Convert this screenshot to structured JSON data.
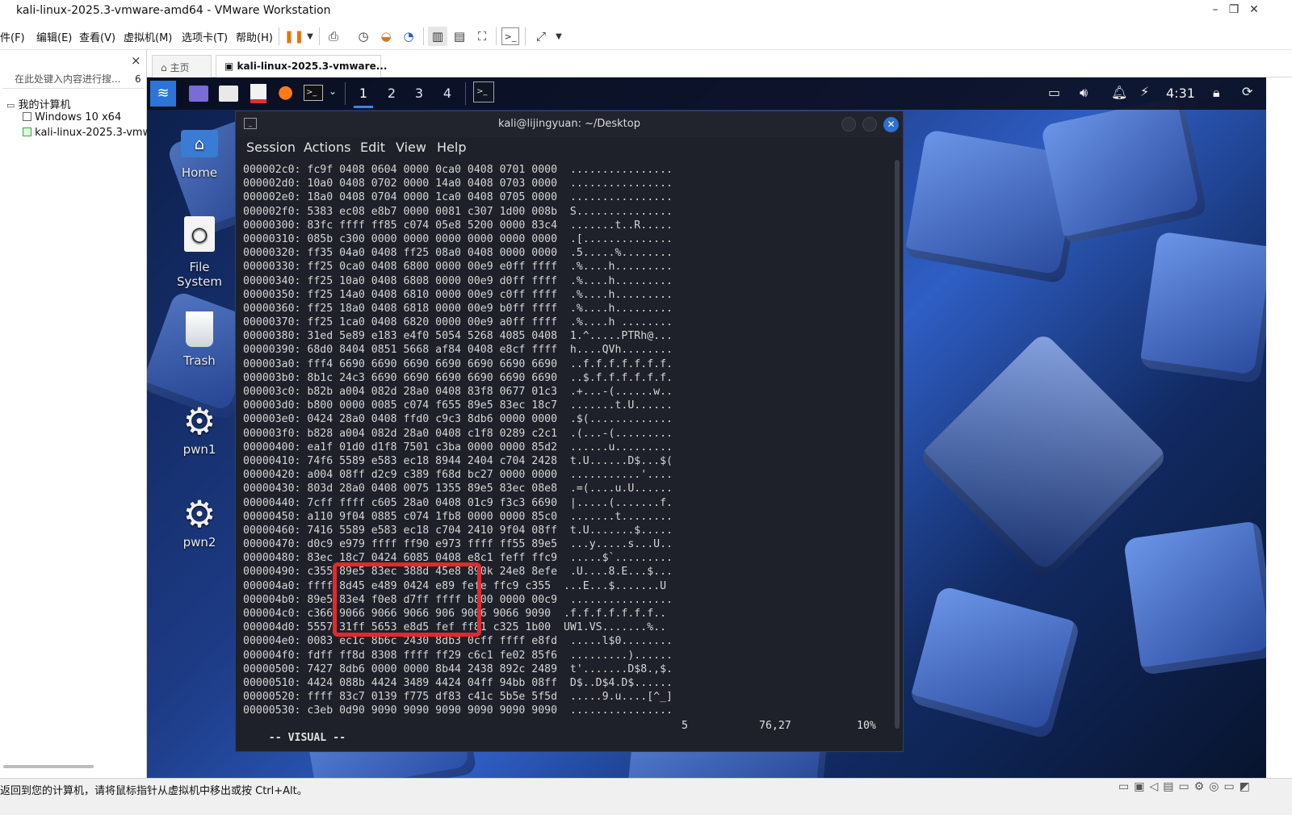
{
  "window": {
    "title": "kali-linux-2025.3-vmware-amd64 - VMware Workstation",
    "minimize": "–",
    "restore": "❐",
    "close": "✕"
  },
  "menu": [
    "件(F)",
    "编辑(E)",
    "查看(V)",
    "虚拟机(M)",
    "选项卡(T)",
    "帮助(H)"
  ],
  "library": {
    "close": "×",
    "search_placeholder": "在此处键入内容进行搜...",
    "search_count": "6",
    "root": "我的计算机",
    "items": [
      "Windows 10 x64",
      "kali-linux-2025.3-vmw"
    ]
  },
  "tabs": [
    {
      "label": "主页",
      "icon": "home-icon"
    },
    {
      "label": "kali-linux-2025.3-vmware...",
      "icon": "vm-icon",
      "active": true
    }
  ],
  "kali_panel": {
    "workspaces": [
      "1",
      "2",
      "3",
      "4"
    ],
    "active_workspace": "1",
    "clock": "4:31"
  },
  "desktop_icons": [
    {
      "label": "Home",
      "icon": "home-folder-icon"
    },
    {
      "label": "File System",
      "icon": "drive-icon"
    },
    {
      "label": "Trash",
      "icon": "trash-icon"
    },
    {
      "label": "pwn1",
      "icon": "gear-icon"
    },
    {
      "label": "pwn2",
      "icon": "gear-icon"
    }
  ],
  "terminal": {
    "title": "kali@lijingyuan: ~/Desktop",
    "menu": [
      "Session",
      "Actions",
      "Edit",
      "View",
      "Help"
    ],
    "lines": [
      "000002c0: fc9f 0408 0604 0000 0ca0 0408 0701 0000  ................",
      "000002d0: 10a0 0408 0702 0000 14a0 0408 0703 0000  ................",
      "000002e0: 18a0 0408 0704 0000 1ca0 0408 0705 0000  ................",
      "000002f0: 5383 ec08 e8b7 0000 0081 c307 1d00 008b  S...............",
      "00000300: 83fc ffff ff85 c074 05e8 5200 0000 83c4  .......t..R.....",
      "00000310: 085b c300 0000 0000 0000 0000 0000 0000  .[..............",
      "00000320: ff35 04a0 0408 ff25 08a0 0408 0000 0000  .5.....%........",
      "00000330: ff25 0ca0 0408 6800 0000 00e9 e0ff ffff  .%....h.........",
      "00000340: ff25 10a0 0408 6808 0000 00e9 d0ff ffff  .%....h.........",
      "00000350: ff25 14a0 0408 6810 0000 00e9 c0ff ffff  .%....h.........",
      "00000360: ff25 18a0 0408 6818 0000 00e9 b0ff ffff  .%....h.........",
      "00000370: ff25 1ca0 0408 6820 0000 00e9 a0ff ffff  .%....h ........",
      "00000380: 31ed 5e89 e183 e4f0 5054 5268 4085 0408  1.^.....PTRh@...",
      "00000390: 68d0 8404 0851 5668 af84 0408 e8cf ffff  h....QVh........",
      "000003a0: fff4 6690 6690 6690 6690 6690 6690 6690  ..f.f.f.f.f.f.f.",
      "000003b0: 8b1c 24c3 6690 6690 6690 6690 6690 6690  ..$.f.f.f.f.f.f.",
      "000003c0: b82b a004 082d 28a0 0408 83f8 0677 01c3  .+...-(......w..",
      "000003d0: b800 0000 0085 c074 f655 89e5 83ec 18c7  .......t.U......",
      "000003e0: 0424 28a0 0408 ffd0 c9c3 8db6 0000 0000  .$(.............",
      "000003f0: b828 a004 082d 28a0 0408 c1f8 0289 c2c1  .(...-(.........",
      "00000400: ea1f 01d0 d1f8 7501 c3ba 0000 0000 85d2  ......u.........",
      "00000410: 74f6 5589 e583 ec18 8944 2404 c704 2428  t.U......D$...$(",
      "00000420: a004 08ff d2c9 c389 f68d bc27 0000 0000  ...........'....",
      "00000430: 803d 28a0 0408 0075 1355 89e5 83ec 08e8  .=(....u.U......",
      "00000440: 7cff ffff c605 28a0 0408 01c9 f3c3 6690  |.....(.......f.",
      "00000450: a110 9f04 0885 c074 1fb8 0000 0000 85c0  .......t........",
      "00000460: 7416 5589 e583 ec18 c704 2410 9f04 08ff  t.U.......$.....",
      "00000470: d0c9 e979 ffff ff90 e973 ffff ff55 89e5  ...y.....s...U..",
      "00000480: 83ec 18c7 0424 6085 0408 e8c1 feff ffc9  .....$`.........",
      "00000490: c355 89e5 83ec 388d 45e8 890k 24e8 8efe  .U....8.E...$...",
      "000004a0: ffff 8d45 e489 0424 e89 fefe ffc9 c355  ...E...$.......U",
      "000004b0: 89e5 83e4 f0e8 d7ff ffff b800 0000 00c9  ................",
      "000004c0: c366 9066 9066 9066 906 9066 9066 9090  .f.f.f.f.f.f.f..",
      "000004d0: 5557 31ff 5653 e8d5 fef ff81 c325 1b00  UW1.VS.......%..",
      "000004e0: 0083 ec1c 8b6c 2430 8db3 0cff ffff e8fd  .....l$0........",
      "000004f0: fdff ff8d 8308 ffff ff29 c6c1 fe02 85f6  .........)......",
      "00000500: 7427 8db6 0000 0000 8b44 2438 892c 2489  t'.......D$8.,$.",
      "00000510: 4424 088b 4424 3489 4424 04ff 94bb 08ff  D$..D$4.D$......",
      "00000520: ffff 83c7 0139 f775 df83 c41c 5b5e 5f5d  .....9.u....[^_]",
      "00000530: c3eb 0d90 9090 9090 9090 9090 9090 9090  ................"
    ],
    "mode": "-- VISUAL --",
    "selected_count": "5",
    "cursor_pos": "76,27",
    "percent": "10%"
  },
  "statusbar": {
    "message": "返回到您的计算机，请将鼠标指针从虚拟机中移出或按 Ctrl+Alt。"
  },
  "colors": {
    "terminal_bg": "#1e2129",
    "highlight": "#e3292e",
    "panel_bg": "#0a0e1e"
  }
}
